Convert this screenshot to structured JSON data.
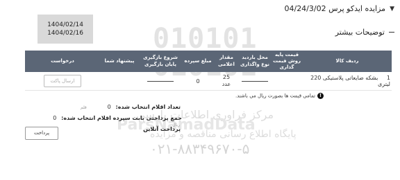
{
  "header": {
    "auction_title": "مزایده ایدکو پرس 04/24/3/02",
    "more_details": "توضیحات بیشتر"
  },
  "dates": {
    "start": "1404/02/14",
    "end": "1404/02/16"
  },
  "watermark": {
    "numbers": "010101\n010101",
    "name": "ParsNamadData",
    "fa_line1": "مرکز فراوری اطلاعات پارسی",
    "fa_line2": "پایگاه اطلاع رسانی مناقصه و مزایده",
    "phone": "۰۲۱-۸۸۳۴۹۶۷۰-۵"
  },
  "table": {
    "headers": [
      "ردیف کالا",
      "قیمت پایه روش قیمت گذاری",
      "محل بارديد نوع واگذاری",
      "مقدار اعلامی",
      "مبلغ سپرده",
      "شروع بازگیری پایان بازگیری",
      "پیشنهاد شما",
      "درخواست"
    ],
    "rows": [
      {
        "index": "1",
        "name": "بشکه ضایعاتی پلاستیکی 220 لیتری",
        "quantity": "25",
        "unit": "عدد",
        "deposit": "0",
        "request_button": "ارسال پاکت"
      }
    ]
  },
  "info_note": "تمامی قیمت ها بصورت ریال می باشند.",
  "summary": {
    "selected_count_label": "تعداد اقلام انتخاب شده:",
    "selected_count_value": "0",
    "selected_count_unit": "قلم",
    "total_payment_label": "جمع پرداختی بابت سپرده اقلام انتخاب شده:",
    "total_payment_value": "0",
    "total_payment_unit": "ریال",
    "online_payment_label": "پرداخت آنلاین"
  },
  "pay_button": "پرداخت"
}
